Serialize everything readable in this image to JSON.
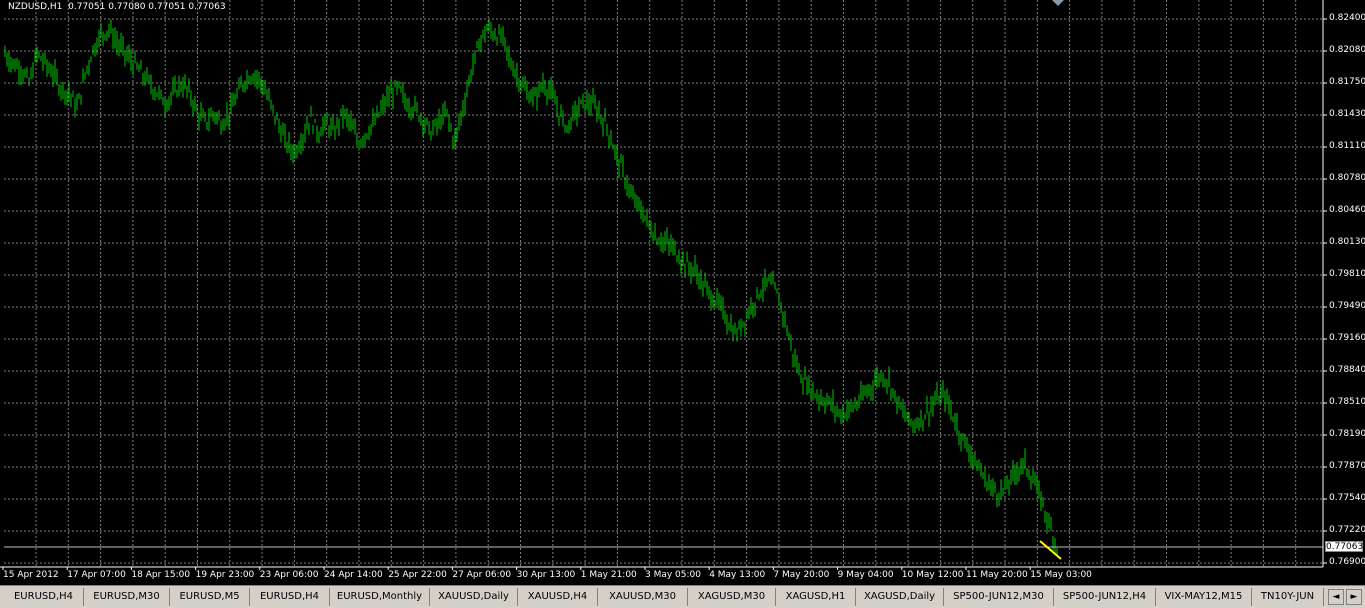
{
  "symbol_info": "NZDUSD,H1  0.77051 0.77080 0.77051 0.77063",
  "current_price": "0.77063",
  "y_axis_labels": [
    "0.82400",
    "0.82080",
    "0.81750",
    "0.81430",
    "0.81110",
    "0.80780",
    "0.80460",
    "0.80130",
    "0.79810",
    "0.79490",
    "0.79160",
    "0.78840",
    "0.78510",
    "0.78190",
    "0.77870",
    "0.77540",
    "0.77220",
    "0.76900"
  ],
  "x_axis_labels": [
    "15 Apr 2012",
    "17 Apr 07:00",
    "18 Apr 15:00",
    "19 Apr 23:00",
    "23 Apr 06:00",
    "24 Apr 14:00",
    "25 Apr 22:00",
    "27 Apr 06:00",
    "30 Apr 13:00",
    "1 May 21:00",
    "3 May 05:00",
    "4 May 13:00",
    "7 May 20:00",
    "9 May 04:00",
    "10 May 12:00",
    "11 May 20:00",
    "15 May 03:00"
  ],
  "tabs": [
    {
      "label": "EURUSD,H4",
      "active": false
    },
    {
      "label": "EURUSD,M30",
      "active": false
    },
    {
      "label": "EURUSD,M5",
      "active": false
    },
    {
      "label": "EURUSD,H4",
      "active": false
    },
    {
      "label": "EURUSD,Monthly",
      "active": false
    },
    {
      "label": "XAUUSD,Daily",
      "active": false
    },
    {
      "label": "XAUUSD,H4",
      "active": false
    },
    {
      "label": "XAUUSD,M30",
      "active": false
    },
    {
      "label": "XAGUSD,M30",
      "active": false
    },
    {
      "label": "XAGUSD,H1",
      "active": false
    },
    {
      "label": "XAGUSD,Daily",
      "active": false
    },
    {
      "label": "SP500-JUN12,M30",
      "active": false
    },
    {
      "label": "SP500-JUN12,H4",
      "active": false
    },
    {
      "label": "VIX-MAY12,M15",
      "active": false
    },
    {
      "label": "TN10Y-JUN",
      "active": false
    }
  ],
  "colors": {
    "background": "#000000",
    "bars": "#00c800",
    "grid": "#808080",
    "trendline": "#ffff00",
    "text": "#ffffff"
  },
  "chart_data": {
    "type": "bar",
    "symbol": "NZDUSD",
    "timeframe": "H1",
    "ylim": [
      0.769,
      0.8245
    ],
    "grid": true,
    "close_path": [
      0.8205,
      0.8195,
      0.819,
      0.8175,
      0.8205,
      0.8195,
      0.8185,
      0.817,
      0.8165,
      0.815,
      0.8185,
      0.821,
      0.8225,
      0.823,
      0.8215,
      0.8205,
      0.8195,
      0.8185,
      0.8175,
      0.8165,
      0.8155,
      0.8165,
      0.8175,
      0.8165,
      0.8145,
      0.8135,
      0.8145,
      0.8135,
      0.8145,
      0.8165,
      0.818,
      0.8185,
      0.8175,
      0.8155,
      0.8135,
      0.8115,
      0.8105,
      0.812,
      0.814,
      0.8125,
      0.8135,
      0.8125,
      0.8145,
      0.8135,
      0.8115,
      0.8125,
      0.8135,
      0.815,
      0.8165,
      0.817,
      0.8155,
      0.815,
      0.814,
      0.8125,
      0.8135,
      0.8145,
      0.8115,
      0.815,
      0.8185,
      0.8215,
      0.823,
      0.8225,
      0.822,
      0.8195,
      0.818,
      0.8165,
      0.816,
      0.8175,
      0.8165,
      0.8145,
      0.813,
      0.8145,
      0.8155,
      0.8155,
      0.8145,
      0.813,
      0.8105,
      0.8085,
      0.806,
      0.805,
      0.8035,
      0.802,
      0.8015,
      0.801,
      0.8,
      0.799,
      0.7985,
      0.797,
      0.796,
      0.795,
      0.7935,
      0.792,
      0.7935,
      0.795,
      0.7965,
      0.7975,
      0.7965,
      0.794,
      0.7905,
      0.788,
      0.787,
      0.786,
      0.7855,
      0.785,
      0.784,
      0.7845,
      0.785,
      0.786,
      0.787,
      0.788,
      0.7875,
      0.7855,
      0.784,
      0.783,
      0.7835,
      0.7845,
      0.7855,
      0.786,
      0.784,
      0.782,
      0.7805,
      0.779,
      0.7775,
      0.7765,
      0.776,
      0.777,
      0.7785,
      0.779,
      0.7775,
      0.7755,
      0.773,
      0.7706
    ]
  }
}
